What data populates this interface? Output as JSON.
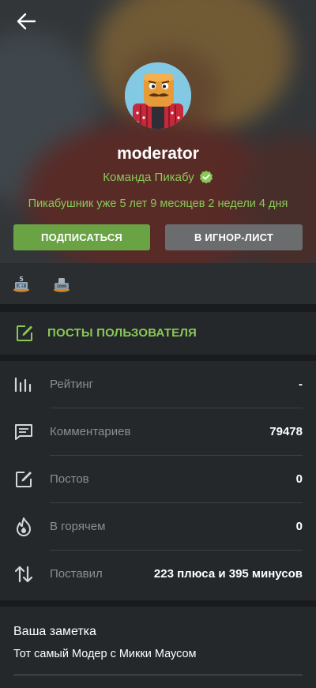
{
  "header": {
    "username": "moderator",
    "team_label": "Команда Пикабу",
    "duration": "Пикабушник уже 5 лет 9 месяцев 2 недели 4 дня",
    "subscribe_label": "ПОДПИСАТЬСЯ",
    "ignore_label": "В ИГНОР-ЛИСТ",
    "accent_color": "#8ac858",
    "subscribe_color": "#6aa344"
  },
  "awards": [
    {
      "icon": "5-years-award-icon"
    },
    {
      "icon": "1000-award-icon"
    }
  ],
  "posts_link": {
    "label": "ПОСТЫ ПОЛЬЗОВАТЕЛЯ",
    "icon": "pencil-square-icon"
  },
  "stats": [
    {
      "label": "Рейтинг",
      "value": "-",
      "icon": "rating-bars-icon"
    },
    {
      "label": "Комментариев",
      "value": "79478",
      "icon": "comment-icon"
    },
    {
      "label": "Постов",
      "value": "0",
      "icon": "pencil-square-icon"
    },
    {
      "label": "В горячем",
      "value": "0",
      "icon": "flame-icon"
    },
    {
      "label": "Поставил",
      "value": "223 плюса и 395 минусов",
      "icon": "up-down-arrows-icon"
    }
  ],
  "note": {
    "title": "Ваша заметка",
    "text": "Тот самый Модер с Микки Маусом"
  }
}
